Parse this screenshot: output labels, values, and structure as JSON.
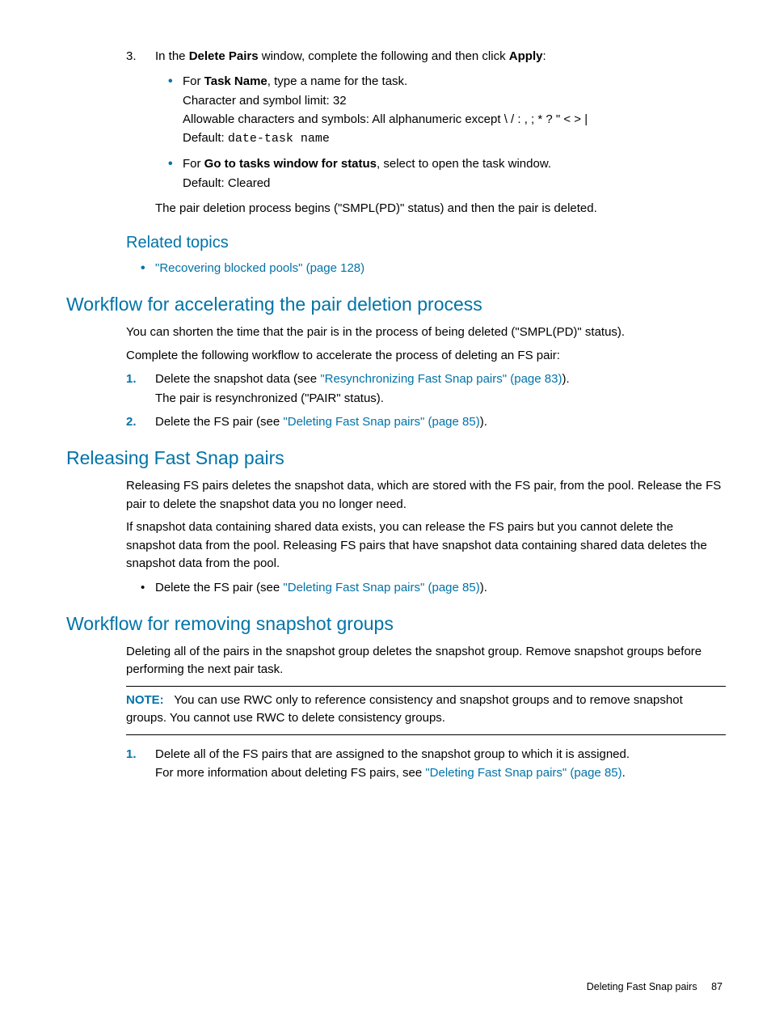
{
  "step3": {
    "marker": "3.",
    "lead_before": "In the ",
    "lead_bold1": "Delete Pairs",
    "lead_mid": " window, complete the following and then click ",
    "lead_bold2": "Apply",
    "lead_after": ":",
    "b1_for": "For ",
    "b1_bold": "Task Name",
    "b1_rest": ", type a name for the task.",
    "b1_l2": "Character and symbol limit: 32",
    "b1_l3": "Allowable characters and symbols: All alphanumeric except \\ / : , ; * ? \" < > |",
    "b1_l4a": "Default: ",
    "b1_l4b": "date-task name",
    "b2_for": "For ",
    "b2_bold": "Go to tasks window for status",
    "b2_rest": ", select to open the task window.",
    "b2_l2": "Default: Cleared",
    "after": "The pair deletion process begins (\"SMPL(PD)\" status) and then the pair is deleted."
  },
  "related": {
    "heading": "Related topics",
    "link": "\"Recovering blocked pools\" (page 128)"
  },
  "accel": {
    "heading": "Workflow for accelerating the pair deletion process",
    "p1": "You can shorten the time that the pair is in the process of being deleted (\"SMPL(PD)\" status).",
    "p2": "Complete the following workflow to accelerate the process of deleting an FS pair:",
    "s1_marker": "1.",
    "s1_before": "Delete the snapshot data (see ",
    "s1_link": "\"Resynchronizing Fast Snap pairs\" (page 83)",
    "s1_after": ").",
    "s1_l2": "The pair is resynchronized (\"PAIR\" status).",
    "s2_marker": "2.",
    "s2_before": "Delete the FS pair (see ",
    "s2_link": "\"Deleting Fast Snap pairs\" (page 85)",
    "s2_after": ")."
  },
  "release": {
    "heading": "Releasing Fast Snap pairs",
    "p1": "Releasing FS pairs deletes the snapshot data, which are stored with the FS pair, from the pool. Release the FS pair to delete the snapshot data you no longer need.",
    "p2": "If snapshot data containing shared data exists, you can release the FS pairs but you cannot delete the snapshot data from the pool. Releasing FS pairs that have snapshot data containing shared data deletes the snapshot data from the pool.",
    "b_before": "Delete the FS pair (see ",
    "b_link": "\"Deleting Fast Snap pairs\" (page 85)",
    "b_after": ")."
  },
  "remove": {
    "heading": "Workflow for removing snapshot groups",
    "p1": "Deleting all of the pairs in the snapshot group deletes the snapshot group. Remove snapshot groups before performing the next pair task.",
    "note_label": "NOTE:",
    "note_text": "You can use RWC only to reference consistency and snapshot groups and to remove snapshot groups. You cannot use RWC to delete consistency groups.",
    "s1_marker": "1.",
    "s1_text": "Delete all of the FS pairs that are assigned to the snapshot group to which it is assigned.",
    "s1_l2_before": "For more information about deleting FS pairs, see ",
    "s1_l2_link": "\"Deleting Fast Snap pairs\" (page 85)",
    "s1_l2_after": "."
  },
  "footer": {
    "section": "Deleting Fast Snap pairs",
    "page": "87"
  }
}
